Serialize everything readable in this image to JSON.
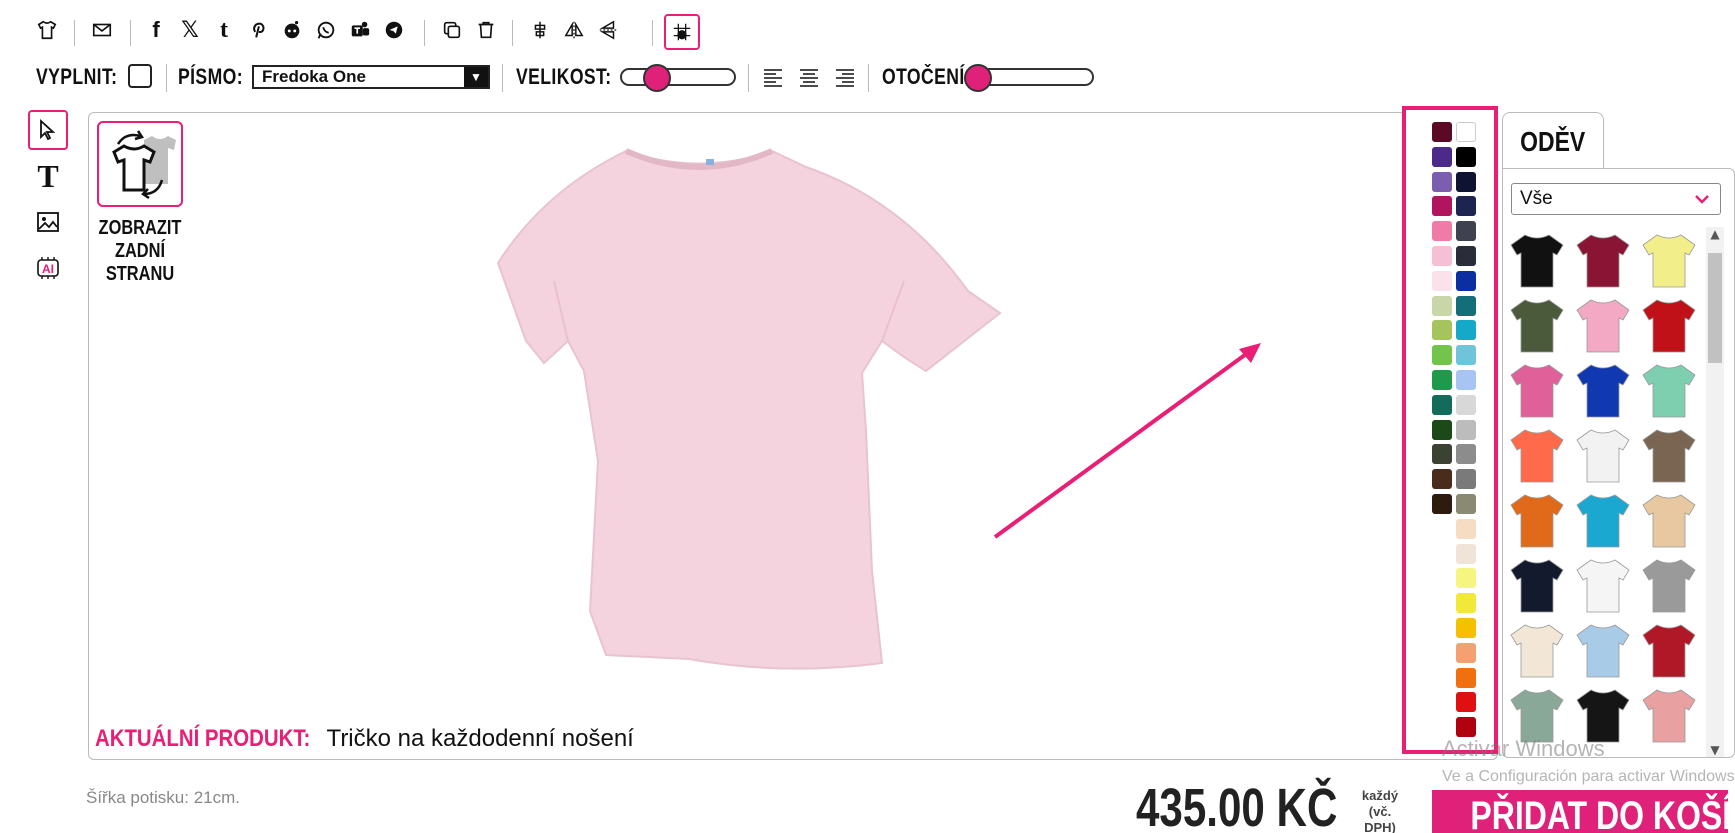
{
  "toolbar": {
    "icons": [
      "tshirt-icon",
      "email-icon",
      "facebook-icon",
      "x-icon",
      "tumblr-icon",
      "pinterest-icon",
      "reddit-icon",
      "whatsapp-icon",
      "teams-icon",
      "telegram-icon",
      "duplicate-icon",
      "delete-icon",
      "center-align-icon",
      "flip-horizontal-icon",
      "flip-vertical-icon",
      "grid-snap-icon"
    ],
    "fill_label": "VYPLNIT:",
    "font_label": "PÍSMO:",
    "font_value": "Fredoka One",
    "size_label": "VELIKOST:",
    "rotation_label": "OTOČENÍ:",
    "size_level": 0.3,
    "rotation_level": 0.0
  },
  "tools": [
    "select-icon",
    "text-icon",
    "image-icon",
    "ai-icon"
  ],
  "canvas": {
    "back_button_label": "ZOBRAZIT ZADNÍ STRANU",
    "current_product_key": "AKTUÁLNÍ PRODUKT:",
    "current_product_value": "Tričko na každodenní nošení",
    "shirt_color": "#f5d3de"
  },
  "palette": {
    "left": [
      "#5a0a24",
      "#4b2a8a",
      "#7b5eb0",
      "#b0155e",
      "#f07aa8",
      "#f6bfd3",
      "#fbe1ea",
      "#c9d6a8",
      "#a6c45e",
      "#72c44a",
      "#1f9a4a",
      "#136b5a",
      "#1b4a18",
      "#3b4232",
      "#4a2c1c",
      "#2e1a0e"
    ],
    "right": [
      "#ffffff",
      "#000000",
      "#0d1330",
      "#1e2450",
      "#3f4050",
      "#2a2c3a",
      "#0b2fa0",
      "#136e7a",
      "#16a8c8",
      "#6fc4dc",
      "#a8c4f2",
      "#d8d8d8",
      "#bcbcbc",
      "#8c8c8c",
      "#7a7a7a",
      "#8a8a74",
      "#f7dcc4",
      "#f0e4d8",
      "#f5f580",
      "#f2e83a",
      "#f5c000",
      "#f5a070",
      "#f07010",
      "#e01010",
      "#b00010"
    ]
  },
  "products": {
    "tab_label": "ODĚV",
    "category": "Vše",
    "items": [
      {
        "name": "black-tshirt",
        "color": "#111111"
      },
      {
        "name": "burgundy-tshirt",
        "color": "#8a1434"
      },
      {
        "name": "yellow-tshirt",
        "color": "#f2ee8a"
      },
      {
        "name": "olive-tshirt",
        "color": "#4a5a3a"
      },
      {
        "name": "pink-womens-tshirt",
        "color": "#f3a8c4"
      },
      {
        "name": "red-tshirt",
        "color": "#c01018"
      },
      {
        "name": "fuchsia-womens-tshirt",
        "color": "#e0609a"
      },
      {
        "name": "royal-blue-tshirt",
        "color": "#1038b0"
      },
      {
        "name": "mint-tshirt",
        "color": "#7ecfb0"
      },
      {
        "name": "coral-womens-tshirt",
        "color": "#ff6a4a"
      },
      {
        "name": "white-tank-top",
        "color": "#f2f2f2"
      },
      {
        "name": "brown-tank-top",
        "color": "#7a6452"
      },
      {
        "name": "orange-hoodie",
        "color": "#e06a1a"
      },
      {
        "name": "turquoise-hoodie",
        "color": "#1aa8d0"
      },
      {
        "name": "tie-dye-tshirt",
        "color": "#e8c8a0"
      },
      {
        "name": "navy-tshirt",
        "color": "#141a2e"
      },
      {
        "name": "raglan-tshirt",
        "color": "#f5f5f5"
      },
      {
        "name": "grey-hoodie",
        "color": "#9a9a9a"
      },
      {
        "name": "cream-tshirt",
        "color": "#f2e6d6"
      },
      {
        "name": "gradient-tshirt",
        "color": "#a8cce8"
      },
      {
        "name": "varsity-jacket",
        "color": "#b01828"
      },
      {
        "name": "sage-longsleeve",
        "color": "#8aa898"
      },
      {
        "name": "black-orange-hoodie",
        "color": "#151515"
      },
      {
        "name": "pink-tank-top",
        "color": "#e8a0a0"
      }
    ]
  },
  "footer": {
    "print_width": "Šířka potisku: 21cm.",
    "price": "435.00 KČ",
    "each_note": "každý (vč. DPH)",
    "add_to_cart": "PŘIDAT DO KOŠÍKU"
  },
  "watermark": {
    "line1": "Activar Windows",
    "line2": "Ve a Configuración para activar Windows."
  }
}
